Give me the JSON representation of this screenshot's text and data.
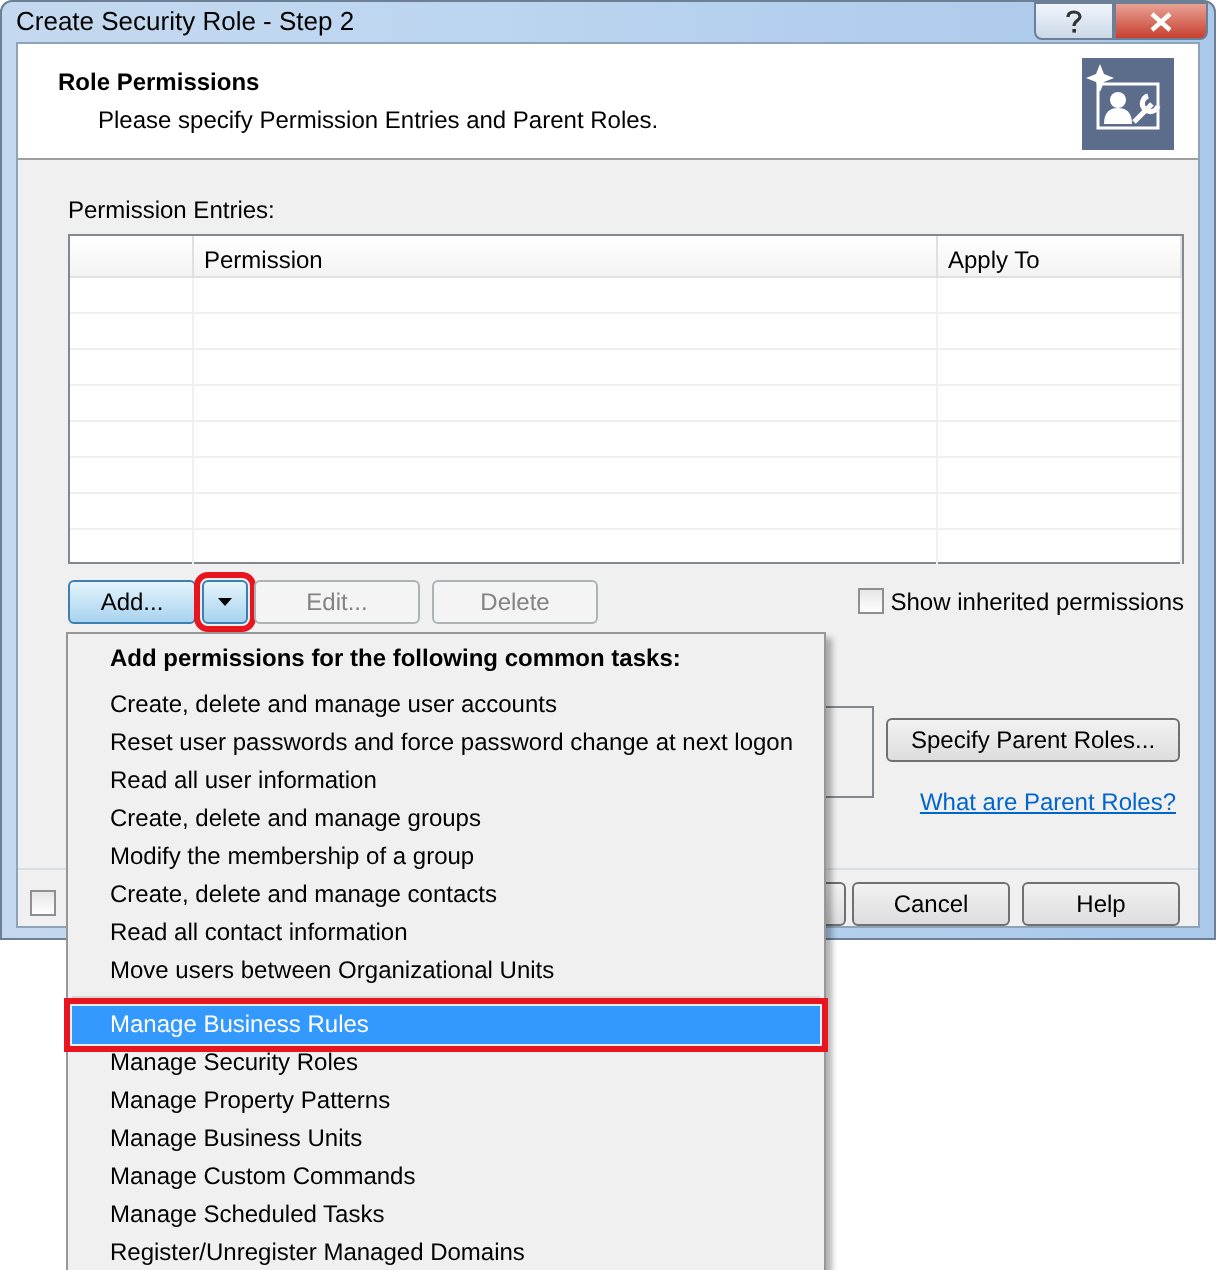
{
  "window": {
    "title": "Create Security Role - Step 2"
  },
  "header": {
    "title": "Role Permissions",
    "subtitle": "Please specify Permission Entries and Parent Roles."
  },
  "permission_entries": {
    "label": "Permission Entries:",
    "columns": [
      "Permission",
      "Apply To"
    ]
  },
  "add_button": {
    "label": "Add...",
    "dropdown_open": true,
    "annotated": true
  },
  "edit_button": {
    "label": "Edit...",
    "disabled": true
  },
  "delete_button": {
    "label": "Delete",
    "disabled": true
  },
  "show_inherited": {
    "label": "Show inherited permissions",
    "checked": false
  },
  "parent_roles": {
    "button": "Specify Parent Roles...",
    "link": "What are Parent Roles?"
  },
  "footer": {
    "checkbox": {
      "checked": false
    },
    "buttons": [
      "Cancel",
      "Help"
    ]
  },
  "menu": {
    "heading": "Add permissions for the following common tasks:",
    "groups": [
      [
        {
          "label": "Create, delete and manage user accounts",
          "selected": false,
          "annotated": false
        },
        {
          "label": "Reset user passwords and force password change at next logon",
          "selected": false,
          "annotated": false
        },
        {
          "label": "Read all user information",
          "selected": false,
          "annotated": false
        },
        {
          "label": "Create, delete and manage groups",
          "selected": false,
          "annotated": false
        },
        {
          "label": "Modify the membership of a group",
          "selected": false,
          "annotated": false
        },
        {
          "label": "Create, delete and manage contacts",
          "selected": false,
          "annotated": false
        },
        {
          "label": "Read all contact information",
          "selected": false,
          "annotated": false
        },
        {
          "label": "Move users between Organizational Units",
          "selected": false,
          "annotated": false
        }
      ],
      [
        {
          "label": "Manage Business Rules",
          "selected": true,
          "annotated": true
        },
        {
          "label": "Manage Security Roles",
          "selected": false,
          "annotated": false
        },
        {
          "label": "Manage Property Patterns",
          "selected": false,
          "annotated": false
        },
        {
          "label": "Manage Business Units",
          "selected": false,
          "annotated": false
        },
        {
          "label": "Manage Custom Commands",
          "selected": false,
          "annotated": false
        },
        {
          "label": "Manage Scheduled Tasks",
          "selected": false,
          "annotated": false
        },
        {
          "label": "Register/Unregister Managed Domains",
          "selected": false,
          "annotated": false
        }
      ]
    ]
  }
}
